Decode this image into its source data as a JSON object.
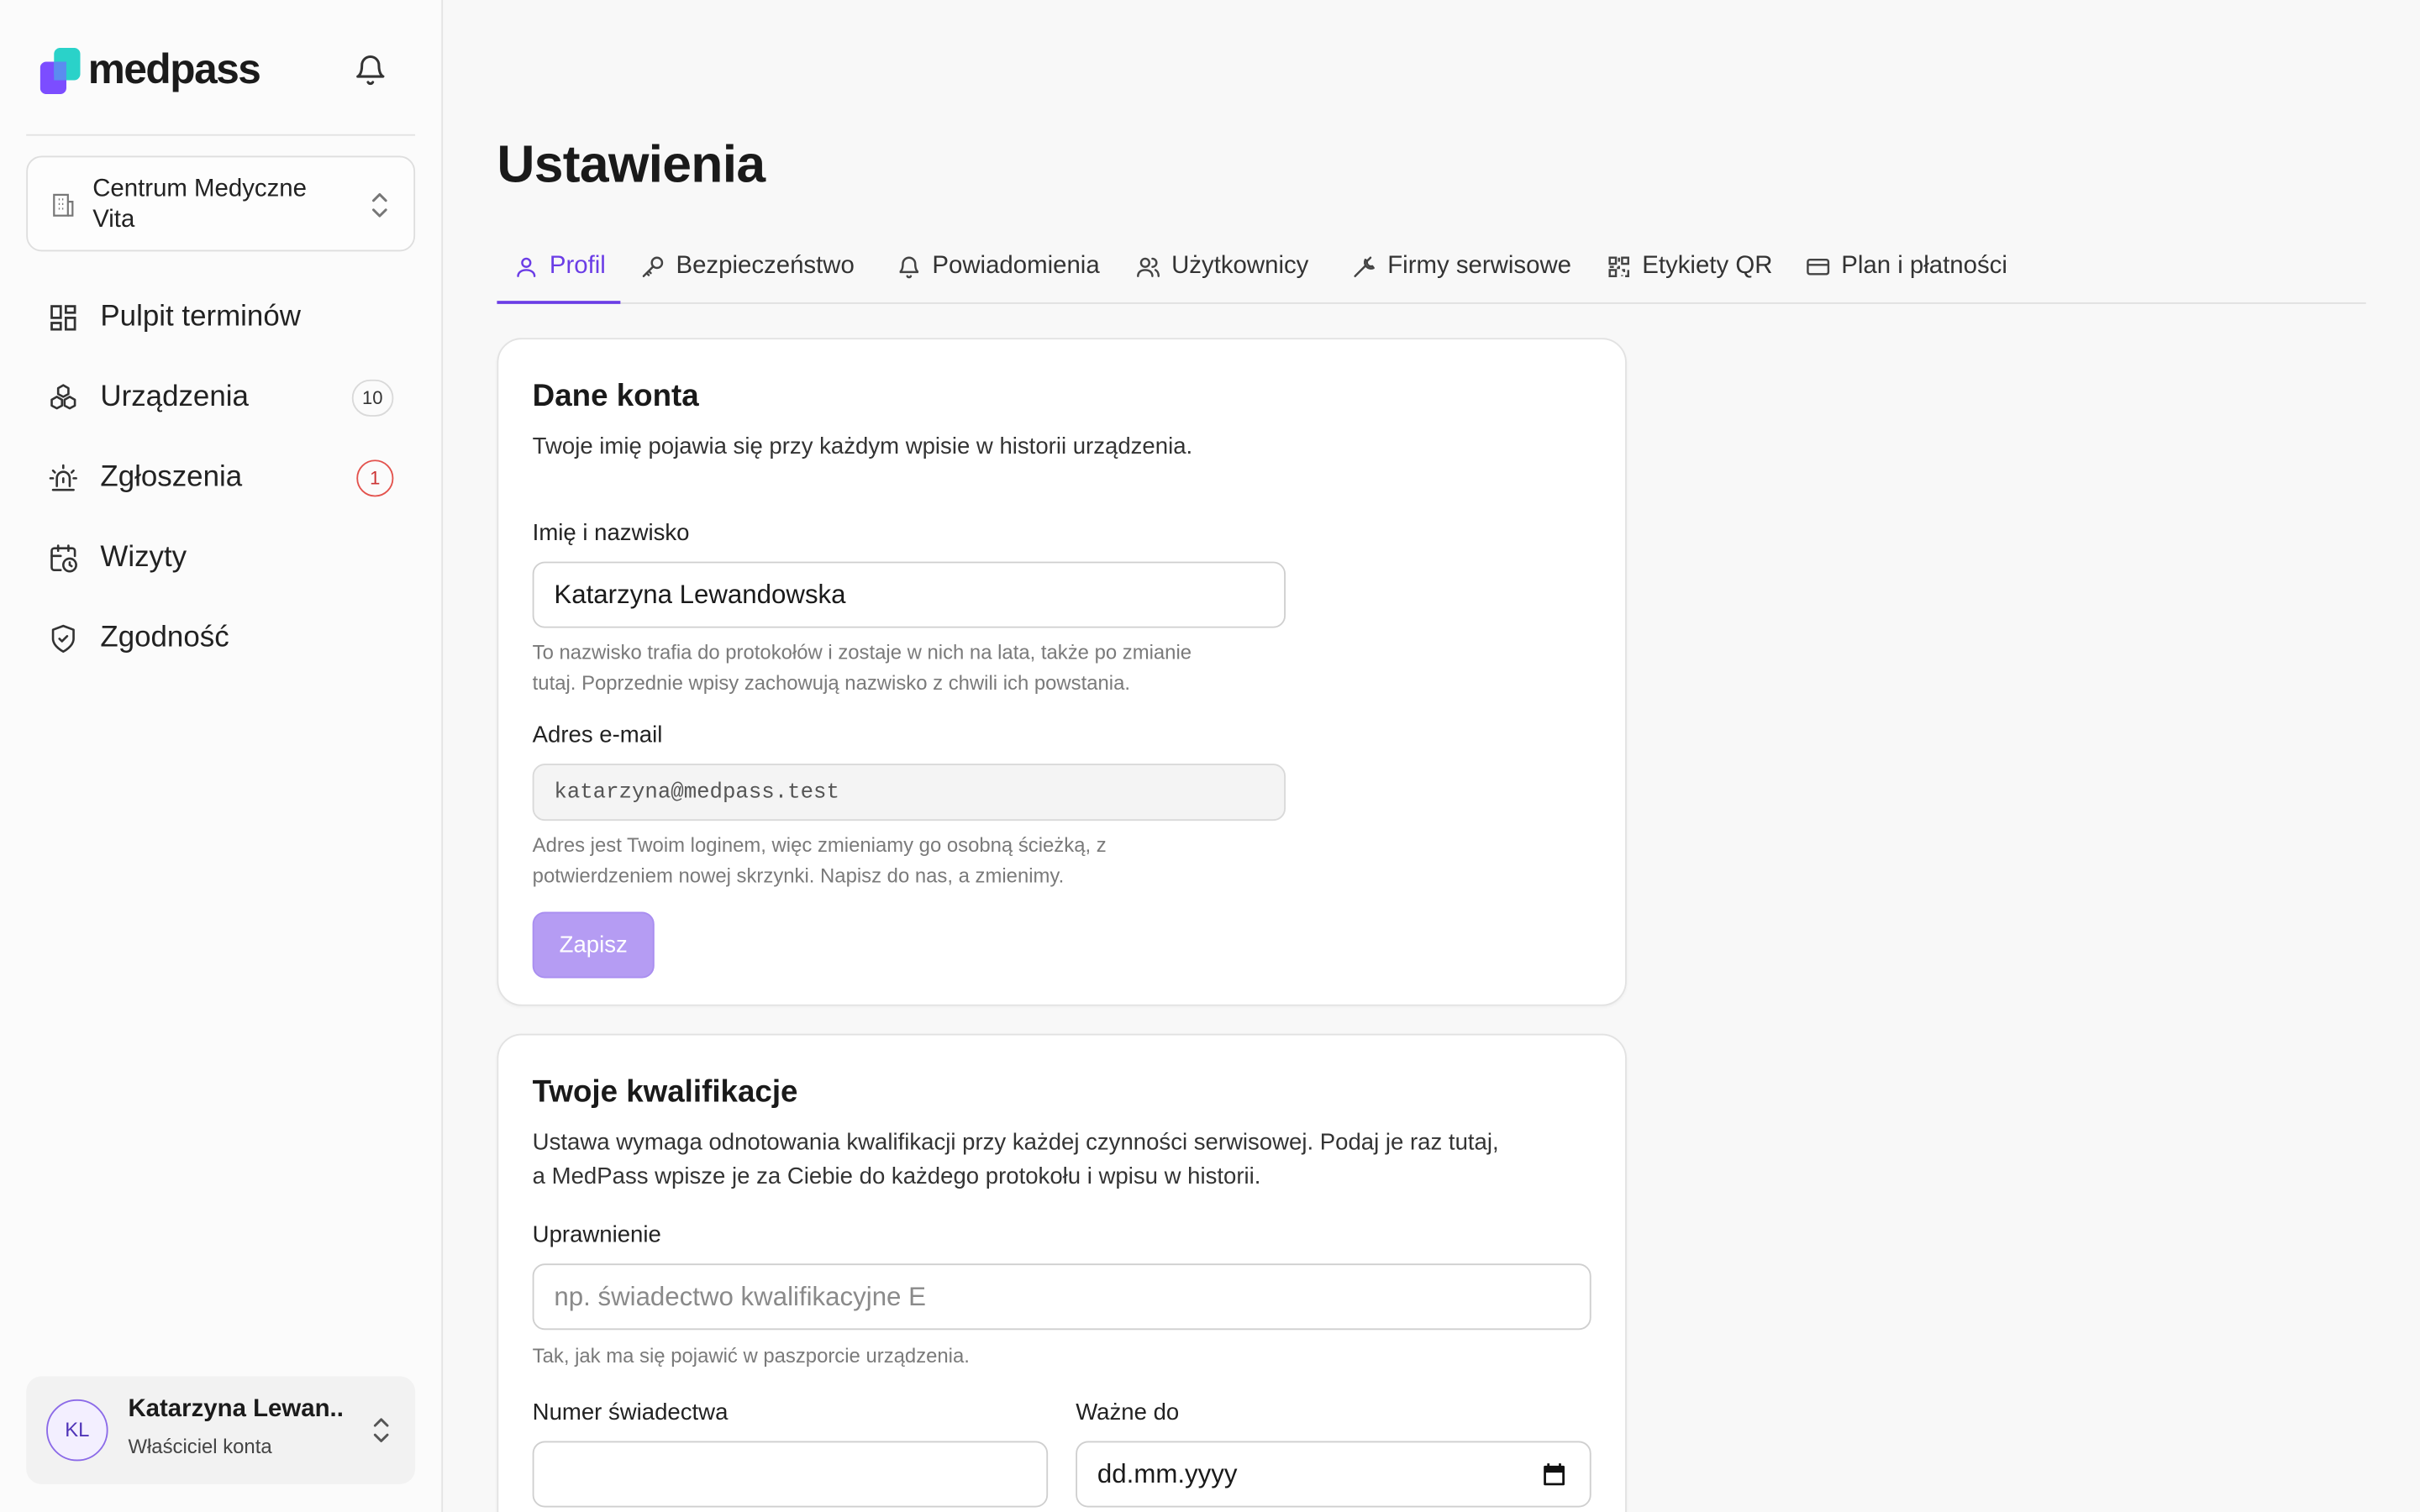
{
  "brand": {
    "name": "medpass"
  },
  "org": {
    "name": "Centrum Medyczne Vita"
  },
  "nav": [
    {
      "label": "Pulpit terminów",
      "icon": "dashboard-icon"
    },
    {
      "label": "Urządzenia",
      "icon": "devices-icon",
      "badge": "10"
    },
    {
      "label": "Zgłoszenia",
      "icon": "alarm-icon",
      "badge": "1"
    },
    {
      "label": "Wizyty",
      "icon": "calendar-clock-icon"
    },
    {
      "label": "Zgodność",
      "icon": "shield-check-icon"
    }
  ],
  "user": {
    "initials": "KL",
    "name": "Katarzyna Lewan...",
    "role": "Właściciel konta"
  },
  "page": {
    "title": "Ustawienia"
  },
  "tabs": [
    {
      "label": "Profil",
      "icon": "user-icon",
      "active": true
    },
    {
      "label": "Bezpieczeństwo",
      "icon": "key-icon"
    },
    {
      "label": "Powiadomienia",
      "icon": "bell-icon"
    },
    {
      "label": "Użytkownicy",
      "icon": "users-icon"
    },
    {
      "label": "Firmy serwisowe",
      "icon": "wrench-icon"
    },
    {
      "label": "Etykiety QR",
      "icon": "qr-icon"
    },
    {
      "label": "Plan i płatności",
      "icon": "card-icon"
    }
  ],
  "account": {
    "title": "Dane konta",
    "desc": "Twoje imię pojawia się przy każdym wpisie w historii urządzenia.",
    "name_label": "Imię i nazwisko",
    "name_value": "Katarzyna Lewandowska",
    "name_hint_1": "To nazwisko trafia do protokołów i zostaje w nich na lata, także po zmianie",
    "name_hint_2": "tutaj. Poprzednie wpisy zachowują nazwisko z chwili ich powstania.",
    "email_label": "Adres e-mail",
    "email_value": "katarzyna@medpass.test",
    "email_hint_1": "Adres jest Twoim loginem, więc zmieniamy go osobną ścieżką, z",
    "email_hint_2": "potwierdzeniem nowej skrzynki. Napisz do nas, a zmienimy.",
    "save_label": "Zapisz"
  },
  "qualifications": {
    "title": "Twoje kwalifikacje",
    "desc_1": "Ustawa wymaga odnotowania kwalifikacji przy każdej czynności serwisowej. Podaj je raz tutaj,",
    "desc_2": "a MedPass wpisze je za Ciebie do każdego protokołu i wpisu w historii.",
    "permission_label": "Uprawnienie",
    "permission_placeholder": "np. świadectwo kwalifikacyjne E",
    "permission_hint": "Tak, jak ma się pojawić w paszporcie urządzenia.",
    "cert_label": "Numer świadectwa",
    "cert_value": "",
    "valid_label": "Ważne do",
    "valid_placeholder": "dd.mm.yyyy"
  },
  "colors": {
    "accent": "#6b3de6",
    "save_button": "#b59cf3",
    "danger": "#e3524d"
  }
}
